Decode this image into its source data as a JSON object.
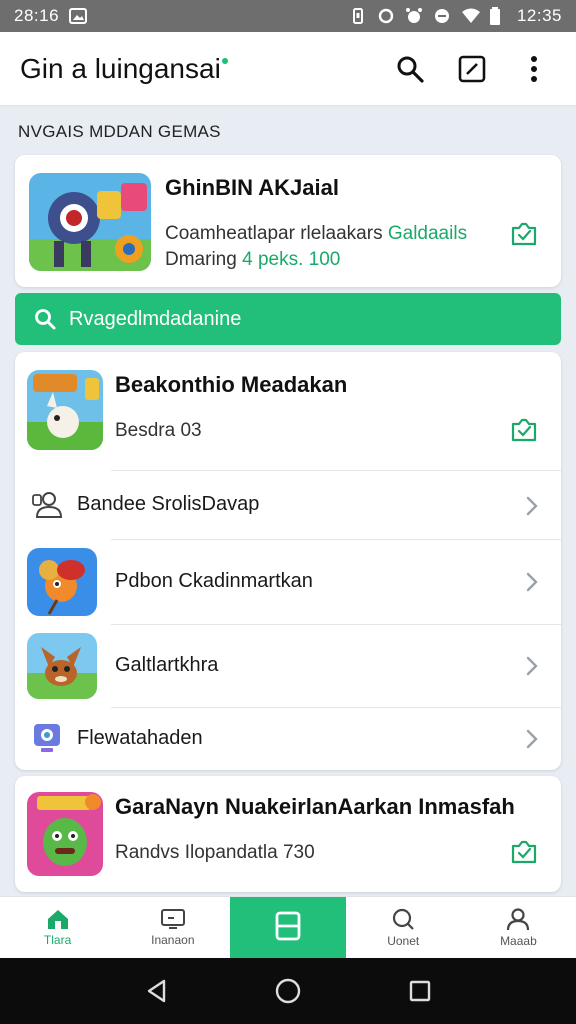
{
  "status_bar": {
    "time_left": "28:16",
    "time_right": "12:35"
  },
  "app_bar": {
    "title": "Gin a luingansai",
    "icons": [
      "search-icon",
      "edit-box-icon",
      "more-vert-icon"
    ]
  },
  "section_label": "NVGAIS MDDAN GEMAS",
  "featured": {
    "title": "GhinBIN AKJaial",
    "line1_prefix": "Coamheatlapar",
    "line1_mid": "rlelaakars",
    "line1_green": "Galdaails",
    "line2_prefix": "Dmaring",
    "line2_green": "4 peks. 100"
  },
  "search": {
    "placeholder": "Rvagedlmdadanine"
  },
  "list_card": {
    "title": "Beakonthio Meadakan",
    "sub": "Besdra 03",
    "rows": [
      {
        "label": "Bandee SrolisDavap",
        "icon": "people-icon"
      },
      {
        "label": "Pdbon Ckadinmartkan",
        "icon": "game-thumb"
      },
      {
        "label": "Galtlartkhra",
        "icon": "game-thumb"
      },
      {
        "label": "Flewatahaden",
        "icon": "webcam-icon"
      }
    ]
  },
  "bottom_card": {
    "title": "GaraNayn NuakeirlanAarkan Inmasfah",
    "sub": "Randvs Ilopandatla 730"
  },
  "bottom_nav": [
    {
      "label": "Tlara",
      "icon": "home-icon"
    },
    {
      "label": "Inanaon",
      "icon": "monitor-icon"
    },
    {
      "label": "",
      "icon": "library-icon"
    },
    {
      "label": "Uonet",
      "icon": "search-icon"
    },
    {
      "label": "Maaab",
      "icon": "profile-icon"
    }
  ],
  "colors": {
    "accent": "#22bf7b",
    "accent_text": "#1ba96a"
  }
}
